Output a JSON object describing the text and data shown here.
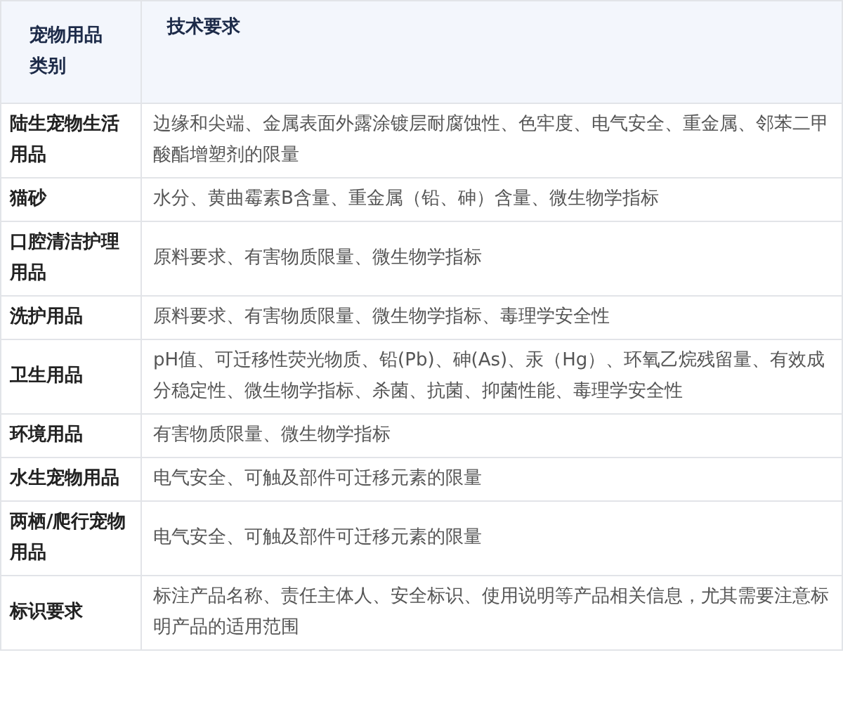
{
  "table": {
    "columns": [
      "宠物用品类别",
      "技术要求"
    ],
    "rows": [
      {
        "category": "陆生宠物生活用品",
        "requirements": "边缘和尖端、金属表面外露涂镀层耐腐蚀性、色牢度、电气安全、重金属、邻苯二甲酸酯增塑剂的限量"
      },
      {
        "category": "猫砂",
        "requirements": "水分、黄曲霉素B含量、重金属（铅、砷）含量、微生物学指标"
      },
      {
        "category": "口腔清洁护理用品",
        "requirements": "原料要求、有害物质限量、微生物学指标"
      },
      {
        "category": "洗护用品",
        "requirements": "原料要求、有害物质限量、微生物学指标、毒理学安全性"
      },
      {
        "category": "卫生用品",
        "requirements": "pH值、可迁移性荧光物质、铅(Pb)、砷(As)、汞（Hg）、环氧乙烷残留量、有效成分稳定性、微生物学指标、杀菌、抗菌、抑菌性能、毒理学安全性"
      },
      {
        "category": "环境用品",
        "requirements": "有害物质限量、微生物学指标"
      },
      {
        "category": "水生宠物用品",
        "requirements": "电气安全、可触及部件可迁移元素的限量"
      },
      {
        "category": "两栖/爬行宠物用品",
        "requirements": "电气安全、可触及部件可迁移元素的限量"
      },
      {
        "category": "标识要求",
        "requirements": "标注产品名称、责任主体人、安全标识、使用说明等产品相关信息，尤其需要注意标明产品的适用范围"
      }
    ]
  }
}
